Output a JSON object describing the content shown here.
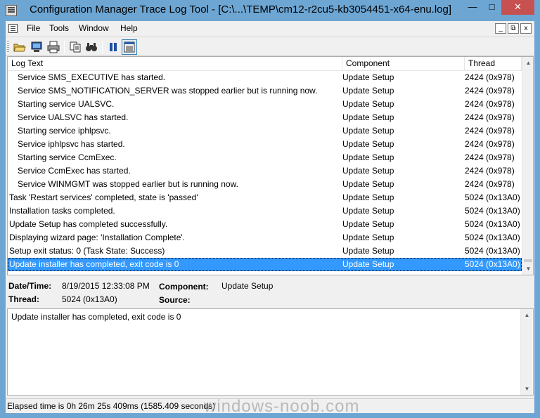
{
  "window": {
    "title": "Configuration Manager Trace Log Tool - [C:\\...\\TEMP\\cm12-r2cu5-kb3054451-x64-enu.log]",
    "minimize_glyph": "—",
    "maximize_glyph": "□",
    "close_glyph": "✕"
  },
  "menu": {
    "file": "File",
    "tools": "Tools",
    "window": "Window",
    "help": "Help",
    "mdi_min": "_",
    "mdi_restore": "⧉",
    "mdi_close": "x"
  },
  "toolbar": {
    "icons": [
      "open-folder-icon",
      "computer-icon",
      "print-icon",
      "copy-icon",
      "find-icon",
      "pause-icon",
      "highlight-icon"
    ]
  },
  "log": {
    "headers": {
      "text": "Log Text",
      "component": "Component",
      "thread": "Thread"
    },
    "rows": [
      {
        "text": "Service SMS_EXECUTIVE has started.",
        "component": "Update Setup",
        "thread": "2424 (0x978)",
        "indent": true
      },
      {
        "text": "Service SMS_NOTIFICATION_SERVER was stopped earlier but is running now.",
        "component": "Update Setup",
        "thread": "2424 (0x978)",
        "indent": true
      },
      {
        "text": "Starting service UALSVC.",
        "component": "Update Setup",
        "thread": "2424 (0x978)",
        "indent": true
      },
      {
        "text": "Service UALSVC has started.",
        "component": "Update Setup",
        "thread": "2424 (0x978)",
        "indent": true
      },
      {
        "text": "Starting service iphlpsvc.",
        "component": "Update Setup",
        "thread": "2424 (0x978)",
        "indent": true
      },
      {
        "text": "Service iphlpsvc has started.",
        "component": "Update Setup",
        "thread": "2424 (0x978)",
        "indent": true
      },
      {
        "text": "Starting service CcmExec.",
        "component": "Update Setup",
        "thread": "2424 (0x978)",
        "indent": true
      },
      {
        "text": "Service CcmExec has started.",
        "component": "Update Setup",
        "thread": "2424 (0x978)",
        "indent": true
      },
      {
        "text": "Service WINMGMT was stopped earlier but is running now.",
        "component": "Update Setup",
        "thread": "2424 (0x978)",
        "indent": true
      },
      {
        "text": "Task 'Restart services' completed, state is 'passed'",
        "component": "Update Setup",
        "thread": "5024 (0x13A0)",
        "indent": false
      },
      {
        "text": "Installation tasks completed.",
        "component": "Update Setup",
        "thread": "5024 (0x13A0)",
        "indent": false
      },
      {
        "text": "Update Setup has completed successfully.",
        "component": "Update Setup",
        "thread": "5024 (0x13A0)",
        "indent": false
      },
      {
        "text": "Displaying wizard page: 'Installation Complete'.",
        "component": "Update Setup",
        "thread": "5024 (0x13A0)",
        "indent": false
      },
      {
        "text": "Setup exit status: 0 (Task State: Success)",
        "component": "Update Setup",
        "thread": "5024 (0x13A0)",
        "indent": false
      },
      {
        "text": "Update installer has completed, exit code is 0",
        "component": "Update Setup",
        "thread": "5024 (0x13A0)",
        "indent": false,
        "selected": true
      }
    ]
  },
  "details": {
    "datetime_label": "Date/Time:",
    "datetime_value": "8/19/2015 12:33:08 PM",
    "component_label": "Component:",
    "component_value": "Update Setup",
    "thread_label": "Thread:",
    "thread_value": "5024 (0x13A0)",
    "source_label": "Source:",
    "source_value": ""
  },
  "message": {
    "text": "Update installer has completed, exit code is 0"
  },
  "status": {
    "text": "Elapsed time is 0h 26m 25s 409ms (1585.409 seconds)"
  },
  "watermark": "windows-noob.com",
  "scroll": {
    "up_glyph": "▲",
    "down_glyph": "▼"
  },
  "colors": {
    "selection": "#3399ff",
    "titlebar": "#6da6d3",
    "close_button": "#c75050"
  }
}
